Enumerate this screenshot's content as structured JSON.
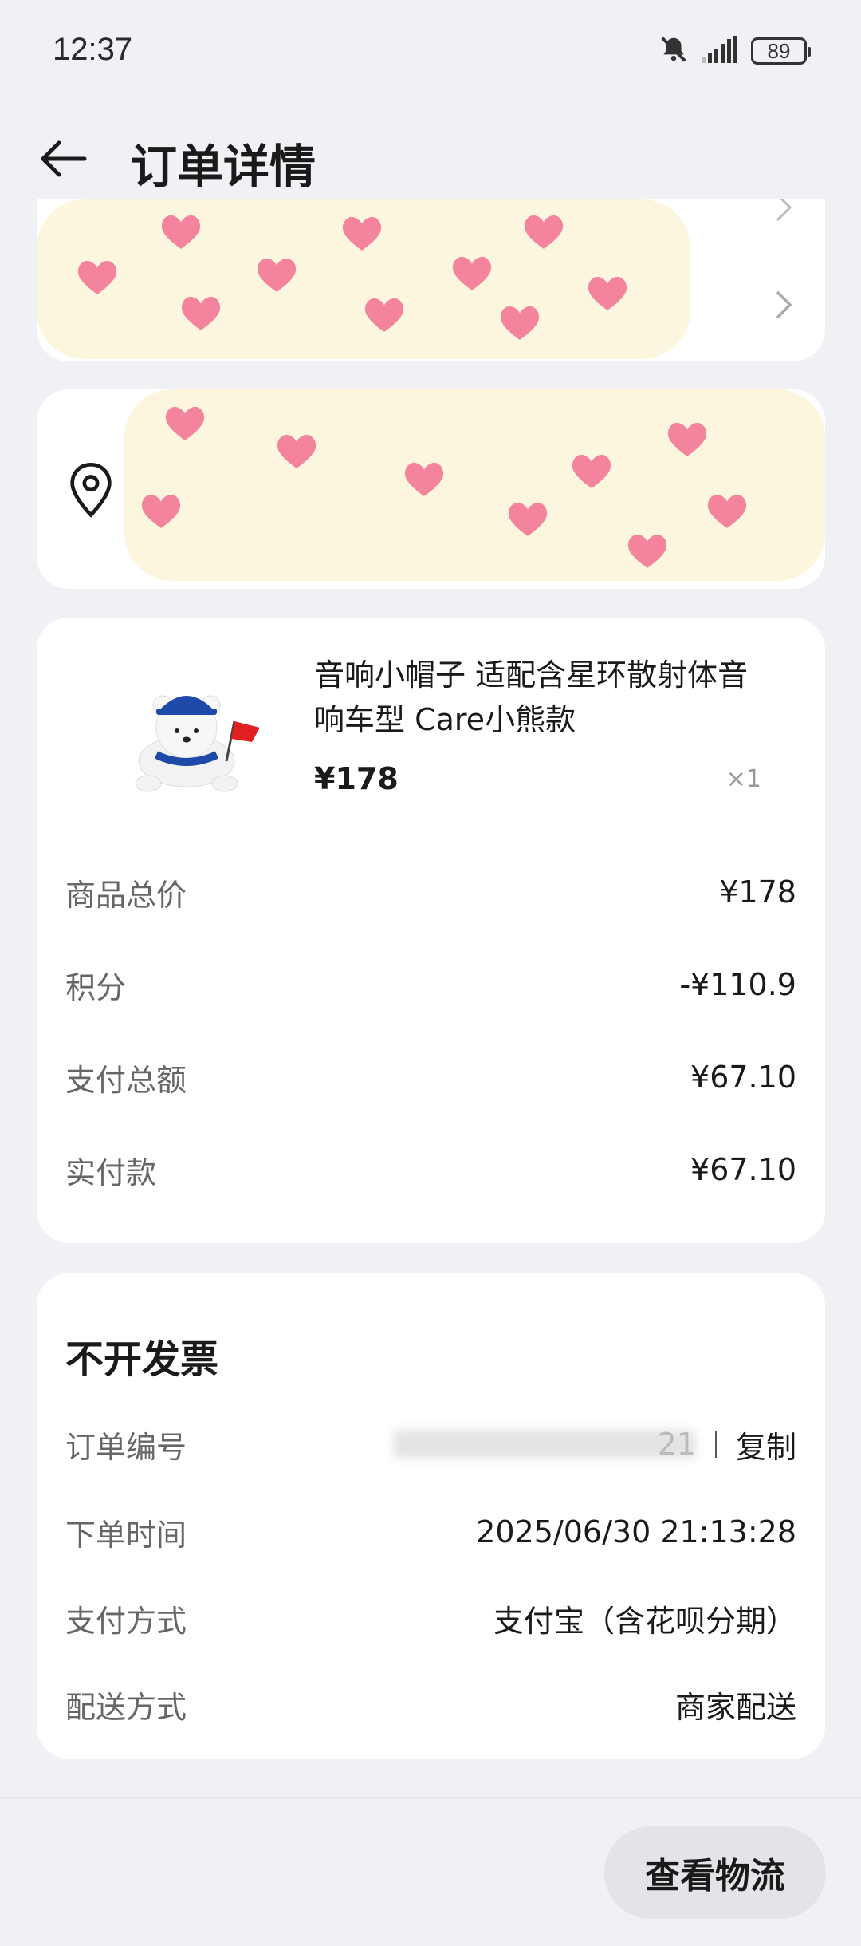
{
  "status_bar": {
    "time": "12:37",
    "battery": "89"
  },
  "header": {
    "title": "订单详情"
  },
  "product": {
    "name": "音响小帽子 适配含星环散射体音响车型 Care小熊款",
    "price": "¥178",
    "quantity": "×1"
  },
  "price_summary": [
    {
      "label": "商品总价",
      "value": "¥178"
    },
    {
      "label": "积分",
      "value": "-¥110.9"
    },
    {
      "label": "支付总额",
      "value": "¥67.10"
    },
    {
      "label": "实付款",
      "value": "¥67.10"
    }
  ],
  "order_info": {
    "invoice": "不开发票",
    "order_number_label": "订单编号",
    "order_number_partial": "21",
    "copy_label": "复制",
    "order_time_label": "下单时间",
    "order_time": "2025/06/30 21:13:28",
    "payment_label": "支付方式",
    "payment": "支付宝（含花呗分期）",
    "delivery_label": "配送方式",
    "delivery": "商家配送"
  },
  "actions": {
    "logistics": "查看物流"
  },
  "colors": {
    "background": "#f0f1f5",
    "card": "#ffffff",
    "heart": "#f4849e",
    "mask": "#fdf6dc"
  }
}
